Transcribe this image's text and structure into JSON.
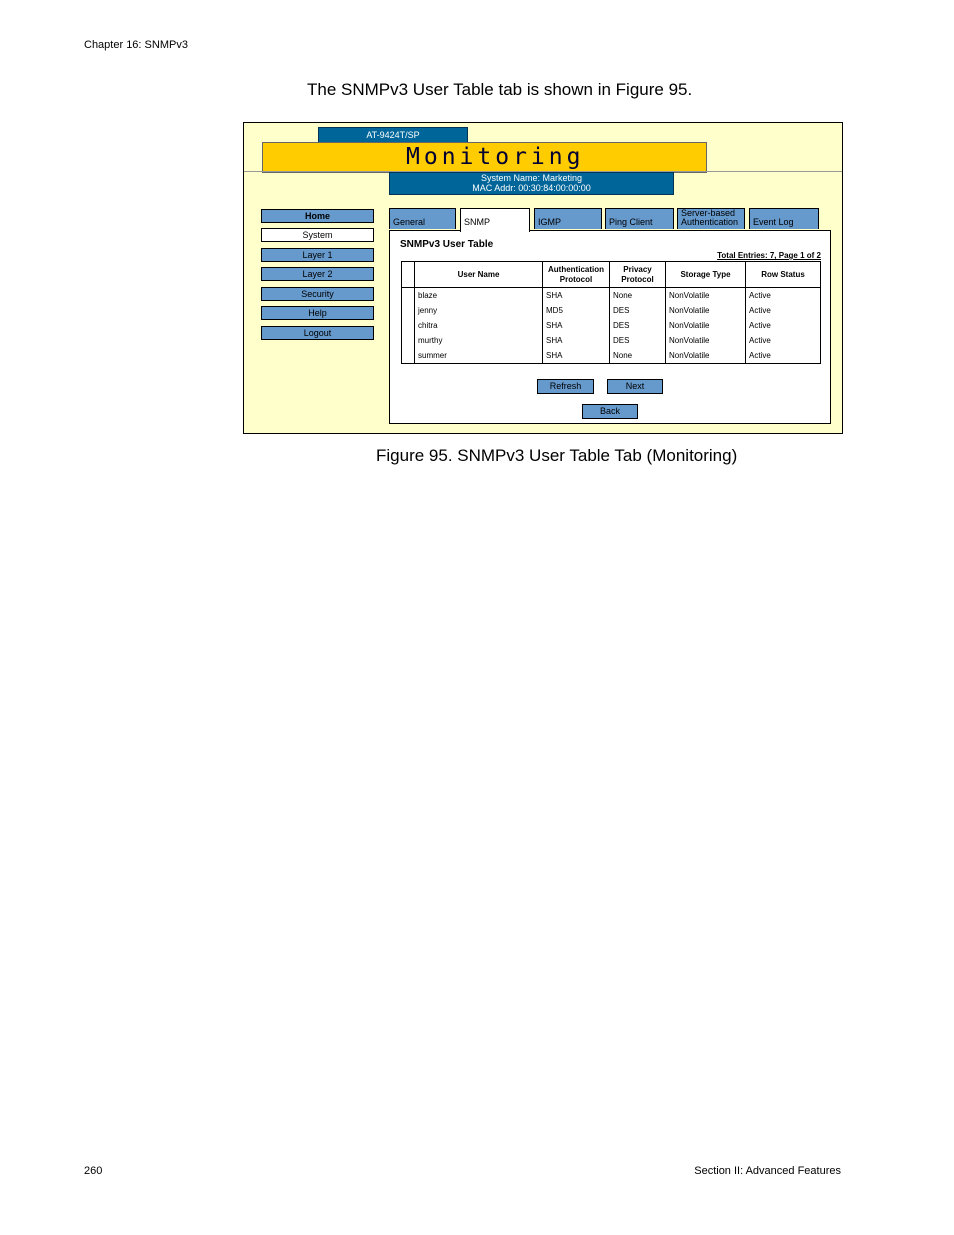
{
  "header": {
    "chapter": "Chapter 16: SNMPv3"
  },
  "intro_text": "The SNMPv3 User Table tab is shown in Figure 95.",
  "screenshot": {
    "model": "AT-9424T/SP",
    "banner_title": "Monitoring",
    "system_name": "System Name: Marketing",
    "mac_addr": "MAC Addr: 00:30:84:00:00:00",
    "nav": [
      "Home",
      "System",
      "Layer 1",
      "Layer 2",
      "Security",
      "Help",
      "Logout"
    ],
    "tabs": [
      "General",
      "SNMP",
      "IGMP",
      "Ping Client",
      "Server-based Authentication",
      "Event Log"
    ],
    "panel_title": "SNMPv3 User Table",
    "total_entries": "Total Entries: 7, Page 1 of 2",
    "columns": [
      "User Name",
      "Authentication Protocol",
      "Privacy Protocol",
      "Storage Type",
      "Row Status"
    ],
    "rows": [
      [
        "blaze",
        "SHA",
        "None",
        "NonVolatile",
        "Active"
      ],
      [
        "jenny",
        "MD5",
        "DES",
        "NonVolatile",
        "Active"
      ],
      [
        "chitra",
        "SHA",
        "DES",
        "NonVolatile",
        "Active"
      ],
      [
        "murthy",
        "SHA",
        "DES",
        "NonVolatile",
        "Active"
      ],
      [
        "summer",
        "SHA",
        "None",
        "NonVolatile",
        "Active"
      ]
    ],
    "buttons": {
      "refresh": "Refresh",
      "next": "Next",
      "back": "Back"
    }
  },
  "caption": "Figure 95.  SNMPv3 User Table Tab (Monitoring)",
  "footer": {
    "page_number": "260",
    "section": "Section II: Advanced Features"
  }
}
